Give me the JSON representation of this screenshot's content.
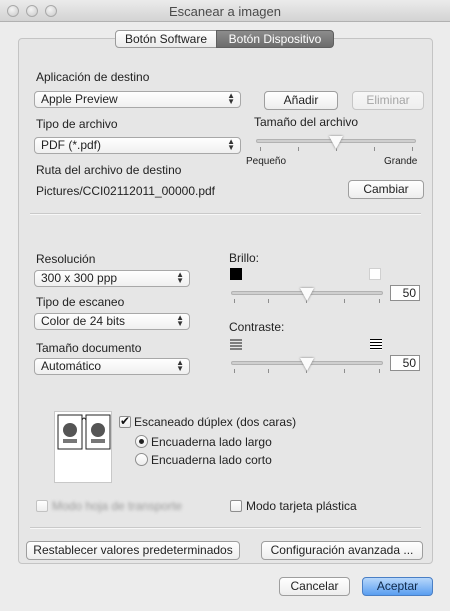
{
  "window": {
    "title": "Escanear a imagen"
  },
  "tabs": [
    {
      "label": "Botón Software",
      "active": false
    },
    {
      "label": "Botón Dispositivo",
      "active": true
    }
  ],
  "destination": {
    "app_label": "Aplicación de destino",
    "app_value": "Apple Preview",
    "add_button": "Añadir",
    "remove_button": "Eliminar"
  },
  "file": {
    "type_label": "Tipo de archivo",
    "type_value": "PDF (*.pdf)",
    "size_label": "Tamaño del archivo",
    "size_min": "Pequeño",
    "size_max": "Grande",
    "size_level": 0.48,
    "path_label": "Ruta del archivo de destino",
    "path_value": "Pictures/CCI02112011_00000.pdf",
    "change_button": "Cambiar"
  },
  "scan": {
    "resolution_label": "Resolución",
    "resolution_value": "300 x 300 ppp",
    "scan_type_label": "Tipo de escaneo",
    "scan_type_value": "Color de 24 bits",
    "doc_size_label": "Tamaño documento",
    "doc_size_value": "Automático",
    "brightness_label": "Brillo:",
    "brightness_value": "50",
    "contrast_label": "Contraste:",
    "contrast_value": "50"
  },
  "duplex": {
    "checkbox_label": "Escaneado dúplex (dos caras)",
    "checked": true,
    "long_edge": "Encuaderna lado largo",
    "short_edge": "Encuaderna lado corto",
    "selected": "long"
  },
  "options": {
    "carrier_sheet": "Modo hoja de transporte",
    "plastic_card": "Modo tarjeta plástica"
  },
  "footer": {
    "reset_button": "Restablecer valores predeterminados",
    "advanced_button": "Configuración avanzada ...",
    "cancel_button": "Cancelar",
    "accept_button": "Aceptar"
  },
  "colors": {
    "accent": "#5a9ef0",
    "selected_tab": "#7a7a7a"
  }
}
